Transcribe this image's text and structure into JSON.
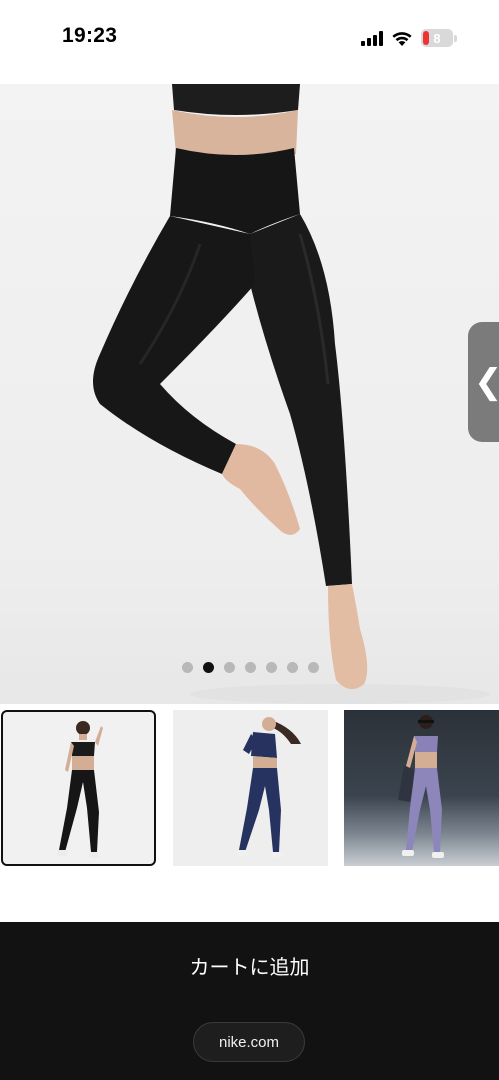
{
  "status_bar": {
    "time": "19:23",
    "battery_level": "8",
    "icons": [
      "signal-icon",
      "wifi-icon",
      "battery-icon"
    ]
  },
  "product_gallery": {
    "image_count": 7,
    "active_index": 1,
    "main_image": "leggings-model-jumping",
    "thumbnails": [
      {
        "name": "black-leggings-set",
        "selected": true
      },
      {
        "name": "navy-leggings-set",
        "selected": false
      },
      {
        "name": "lavender-leggings-set",
        "selected": false
      }
    ]
  },
  "side_handle": {
    "glyph": "❮"
  },
  "footer": {
    "cart_label": "カートに追加",
    "url": "nike.com"
  },
  "colors": {
    "footer_bg": "#121212",
    "active_dot": "#111111",
    "inactive_dot": "#b8b8b8",
    "handle": "#7b7b7b"
  }
}
